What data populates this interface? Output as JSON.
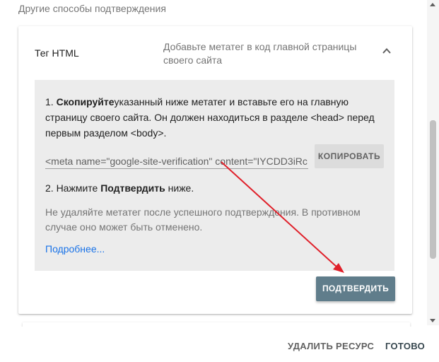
{
  "section": {
    "title": "Другие способы подтверждения"
  },
  "card": {
    "title": "Тег HTML",
    "description": "Добавьте метатег в код главной страницы своего сайта",
    "step1_bold": "Скопируйте",
    "step1_text": "указанный ниже метатег и вставьте его на главную страницу своего сайта. Он должен находиться в разделе <head> перед первым разделом <body>.",
    "meta_value": "<meta name=\"google-site-verification\" content=\"IYCDD3iRc",
    "copy_label": "КОПИРОВАТЬ",
    "step2_prefix": "2. Нажмите ",
    "step2_bold": "Подтвердить",
    "step2_suffix": " ниже.",
    "note": "Не удаляйте метатег после успешного подтверждения. В противном случае оно может быть отменено.",
    "more_link": "Подробнее...",
    "confirm_label": "ПОДТВЕРДИТЬ"
  },
  "footer": {
    "delete_label": "УДАЛИТЬ РЕСУРС",
    "done_label": "ГОТОВО"
  },
  "colors": {
    "confirm_button": "#607d8b",
    "link": "#1a73e8",
    "panel": "#ececec",
    "arrow": "#e0202a"
  },
  "icons": {
    "collapse": "chevron-up-icon"
  }
}
